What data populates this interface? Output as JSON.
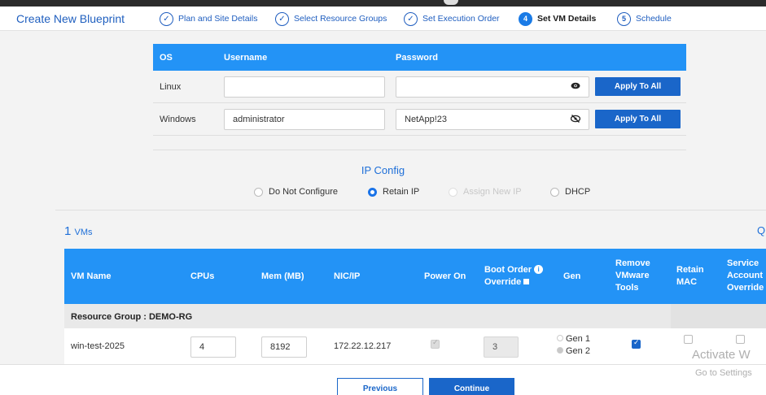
{
  "header": {
    "title": "Create New Blueprint",
    "steps": [
      {
        "num": "✓",
        "label": "Plan and Site Details"
      },
      {
        "num": "✓",
        "label": "Select Resource Groups"
      },
      {
        "num": "✓",
        "label": "Set Execution Order"
      },
      {
        "num": "4",
        "label": "Set VM Details"
      },
      {
        "num": "5",
        "label": "Schedule"
      }
    ]
  },
  "credentials": {
    "headers": {
      "os": "OS",
      "username": "Username",
      "password": "Password"
    },
    "rows": [
      {
        "os": "Linux",
        "username": "",
        "password": "",
        "apply": "Apply To All"
      },
      {
        "os": "Windows",
        "username": "administrator",
        "password": "NetApp!23",
        "apply": "Apply To All"
      }
    ],
    "eye_show": "👁",
    "eye_hide": "⊘"
  },
  "ip_config": {
    "title": "IP Config",
    "options": [
      "Do Not Configure",
      "Retain IP",
      "Assign New IP",
      "DHCP"
    ],
    "selected": "Retain IP"
  },
  "vms": {
    "count": "1",
    "count_label": "VMs",
    "search_icon": "Q",
    "headers": {
      "vm_name": "VM Name",
      "cpus": "CPUs",
      "mem": "Mem (MB)",
      "nic": "NIC/IP",
      "power": "Power On",
      "boot1": "Boot Order",
      "boot2": "Override",
      "gen": "Gen",
      "remove1": "Remove",
      "remove2": "VMware",
      "remove3": "Tools",
      "retain1": "Retain",
      "retain2": "MAC",
      "svc1": "Service",
      "svc2": "Account",
      "svc3": "Override"
    },
    "resource_group": "Resource Group : DEMO-RG",
    "rows": [
      {
        "name": "win-test-2025",
        "cpus": "4",
        "mem": "8192",
        "nic": "172.22.12.217",
        "boot_order": "3",
        "gen1": "Gen 1",
        "gen2": "Gen 2"
      }
    ]
  },
  "footer": {
    "previous": "Previous",
    "continue": "Continue"
  },
  "watermark": {
    "line1": "Activate W",
    "line2": "Go to Settings"
  }
}
